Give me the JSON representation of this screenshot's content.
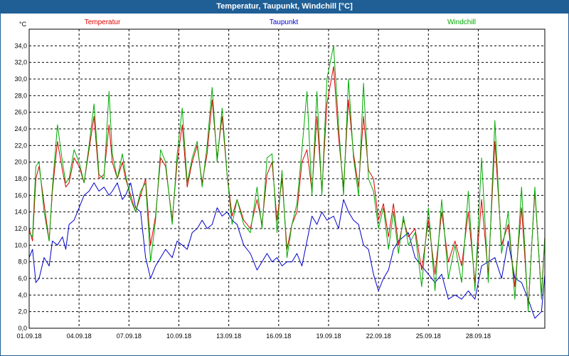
{
  "window": {
    "title": "Temperatur, Taupunkt, Windchill [°C]"
  },
  "chart_data": {
    "type": "line",
    "title": "Temperatur, Taupunkt, Windchill [°C]",
    "ylabel": "°C",
    "xlabel": "",
    "ylim": [
      0,
      36
    ],
    "y_ticks": [
      "0,0",
      "2,0",
      "4,0",
      "6,0",
      "8,0",
      "10,0",
      "12,0",
      "14,0",
      "16,0",
      "18,0",
      "20,0",
      "22,0",
      "24,0",
      "26,0",
      "28,0",
      "30,0",
      "32,0",
      "34,0"
    ],
    "x_ticks": [
      "01.09.18",
      "04.09.18",
      "07.09.18",
      "10.09.18",
      "13.09.18",
      "16.09.18",
      "19.09.18",
      "22.09.18",
      "25.09.18",
      "28.09.18"
    ],
    "x_range_days": [
      0,
      31
    ],
    "grid": true,
    "legend": "top",
    "series": [
      {
        "name": "Temperatur",
        "color": "#dd0000",
        "x": [
          0,
          0.2,
          0.4,
          0.6,
          0.9,
          1.2,
          1.4,
          1.7,
          2.0,
          2.2,
          2.4,
          2.7,
          3.0,
          3.3,
          3.6,
          3.9,
          4.2,
          4.5,
          4.8,
          5.0,
          5.3,
          5.6,
          5.8,
          6.1,
          6.4,
          6.7,
          7.0,
          7.3,
          7.6,
          7.9,
          8.2,
          8.6,
          8.9,
          9.2,
          9.5,
          9.8,
          10.1,
          10.4,
          10.7,
          11.0,
          11.3,
          11.6,
          11.9,
          12.2,
          12.5,
          12.9,
          13.3,
          13.7,
          14.0,
          14.3,
          14.6,
          14.9,
          15.2,
          15.5,
          15.8,
          16.1,
          16.4,
          16.7,
          17.0,
          17.3,
          17.6,
          17.9,
          18.3,
          18.6,
          18.9,
          19.2,
          19.5,
          19.8,
          20.1,
          20.4,
          20.7,
          21.0,
          21.3,
          21.6,
          21.9,
          22.2,
          22.5,
          22.8,
          23.2,
          23.6,
          24.0,
          24.4,
          24.8,
          25.2,
          25.6,
          26.0,
          26.4,
          26.8,
          27.2,
          27.6,
          28.0,
          28.4,
          28.8,
          29.2,
          29.6,
          30.0,
          30.4,
          30.8,
          31.0
        ],
        "values": [
          12.0,
          10.5,
          18.0,
          19.5,
          15.0,
          10.5,
          16.5,
          22.5,
          19.0,
          17.0,
          17.5,
          20.5,
          19.5,
          17.5,
          21.5,
          25.5,
          18.0,
          18.5,
          24.5,
          20.0,
          18.0,
          20.0,
          18.0,
          16.0,
          14.0,
          16.0,
          18.0,
          10.0,
          13.5,
          20.5,
          19.5,
          13.0,
          20.0,
          24.5,
          17.0,
          20.0,
          22.0,
          17.5,
          21.0,
          27.5,
          20.5,
          25.5,
          18.5,
          13.5,
          15.5,
          13.0,
          12.0,
          15.5,
          12.5,
          18.5,
          20.0,
          13.0,
          18.0,
          9.5,
          12.5,
          14.0,
          20.0,
          21.5,
          16.5,
          25.5,
          16.5,
          27.0,
          31.5,
          23.0,
          17.0,
          27.5,
          21.0,
          17.0,
          25.5,
          19.0,
          18.0,
          13.0,
          15.0,
          11.0,
          15.0,
          10.0,
          13.0,
          11.0,
          12.0,
          7.0,
          13.0,
          6.5,
          14.0,
          8.0,
          10.5,
          7.5,
          14.0,
          5.5,
          15.5,
          6.5,
          22.5,
          10.0,
          12.5,
          5.0,
          14.5,
          2.5,
          16.5,
          4.0,
          11.0
        ]
      },
      {
        "name": "Taupunkt",
        "color": "#0000cc",
        "x": [
          0,
          0.2,
          0.4,
          0.6,
          0.9,
          1.2,
          1.4,
          1.7,
          2.0,
          2.2,
          2.4,
          2.7,
          3.0,
          3.3,
          3.6,
          3.9,
          4.2,
          4.5,
          4.8,
          5.0,
          5.3,
          5.6,
          5.8,
          6.1,
          6.4,
          6.7,
          7.0,
          7.3,
          7.6,
          7.9,
          8.2,
          8.6,
          8.9,
          9.2,
          9.5,
          9.8,
          10.1,
          10.4,
          10.7,
          11.0,
          11.3,
          11.6,
          11.9,
          12.2,
          12.5,
          12.9,
          13.3,
          13.7,
          14.0,
          14.3,
          14.6,
          14.9,
          15.2,
          15.5,
          15.8,
          16.1,
          16.4,
          16.7,
          17.0,
          17.3,
          17.6,
          17.9,
          18.3,
          18.6,
          18.9,
          19.2,
          19.5,
          19.8,
          20.1,
          20.4,
          20.7,
          21.0,
          21.3,
          21.6,
          21.9,
          22.2,
          22.5,
          22.8,
          23.2,
          23.6,
          24.0,
          24.4,
          24.8,
          25.2,
          25.6,
          26.0,
          26.4,
          26.8,
          27.2,
          27.6,
          28.0,
          28.4,
          28.8,
          29.2,
          29.6,
          30.0,
          30.4,
          30.8,
          31.0
        ],
        "values": [
          8.5,
          9.5,
          5.5,
          6.0,
          8.5,
          7.5,
          10.5,
          10.0,
          11.0,
          9.5,
          12.5,
          13.0,
          14.5,
          16.0,
          16.5,
          17.5,
          16.5,
          17.0,
          16.0,
          16.5,
          17.5,
          15.5,
          16.0,
          17.5,
          14.5,
          14.0,
          8.5,
          6.0,
          7.5,
          8.5,
          9.5,
          8.5,
          10.5,
          10.0,
          9.5,
          11.5,
          12.0,
          13.0,
          12.0,
          12.5,
          14.5,
          13.5,
          14.0,
          13.0,
          12.5,
          10.0,
          9.0,
          7.0,
          8.0,
          9.0,
          8.0,
          8.5,
          7.5,
          8.0,
          8.0,
          9.0,
          7.5,
          10.5,
          13.5,
          12.5,
          14.0,
          13.0,
          13.5,
          12.0,
          15.5,
          14.0,
          13.0,
          12.5,
          10.0,
          9.5,
          6.5,
          4.5,
          6.0,
          7.0,
          9.5,
          10.5,
          11.0,
          11.5,
          8.5,
          7.5,
          6.5,
          5.5,
          6.5,
          3.5,
          4.0,
          3.5,
          4.5,
          3.5,
          7.5,
          8.0,
          8.5,
          6.0,
          10.5,
          6.0,
          5.5,
          3.5,
          1.2,
          2.0,
          6.5
        ]
      },
      {
        "name": "Windchill",
        "color": "#00aa00",
        "x": [
          0,
          0.2,
          0.4,
          0.6,
          0.9,
          1.2,
          1.4,
          1.7,
          2.0,
          2.2,
          2.4,
          2.7,
          3.0,
          3.3,
          3.6,
          3.9,
          4.2,
          4.5,
          4.8,
          5.0,
          5.3,
          5.6,
          5.8,
          6.1,
          6.4,
          6.7,
          7.0,
          7.3,
          7.6,
          7.9,
          8.2,
          8.6,
          8.9,
          9.2,
          9.5,
          9.8,
          10.1,
          10.4,
          10.7,
          11.0,
          11.3,
          11.6,
          11.9,
          12.2,
          12.5,
          12.9,
          13.3,
          13.7,
          14.0,
          14.3,
          14.6,
          14.9,
          15.2,
          15.5,
          15.8,
          16.1,
          16.4,
          16.7,
          17.0,
          17.3,
          17.6,
          17.9,
          18.3,
          18.6,
          18.9,
          19.2,
          19.5,
          19.8,
          20.1,
          20.4,
          20.7,
          21.0,
          21.3,
          21.6,
          21.9,
          22.2,
          22.5,
          22.8,
          23.2,
          23.6,
          24.0,
          24.4,
          24.8,
          25.2,
          25.6,
          26.0,
          26.4,
          26.8,
          27.2,
          27.6,
          28.0,
          28.4,
          28.8,
          29.2,
          29.6,
          30.0,
          30.4,
          30.8,
          31.0
        ],
        "values": [
          11.5,
          11.0,
          19.5,
          20.0,
          14.0,
          10.5,
          17.0,
          24.5,
          20.0,
          17.5,
          18.0,
          21.5,
          20.0,
          17.5,
          22.0,
          27.0,
          18.5,
          18.0,
          28.5,
          21.0,
          18.0,
          21.0,
          18.5,
          15.5,
          14.0,
          16.5,
          17.5,
          8.0,
          13.0,
          21.5,
          20.0,
          12.5,
          21.0,
          26.5,
          17.5,
          20.5,
          22.5,
          17.0,
          22.0,
          29.0,
          20.0,
          26.5,
          18.5,
          12.5,
          15.5,
          12.5,
          11.5,
          17.0,
          12.0,
          20.5,
          21.0,
          11.5,
          19.0,
          8.5,
          12.5,
          15.0,
          21.5,
          28.5,
          16.0,
          28.5,
          16.0,
          30.0,
          34.0,
          24.5,
          16.0,
          30.0,
          20.5,
          16.0,
          29.5,
          18.0,
          16.5,
          12.0,
          14.5,
          9.5,
          14.0,
          9.0,
          13.5,
          10.0,
          11.5,
          5.0,
          14.5,
          4.5,
          15.5,
          6.0,
          10.0,
          5.5,
          16.5,
          4.5,
          20.5,
          5.5,
          25.0,
          9.0,
          14.0,
          3.5,
          17.0,
          2.0,
          17.0,
          3.5,
          11.0
        ]
      }
    ]
  }
}
